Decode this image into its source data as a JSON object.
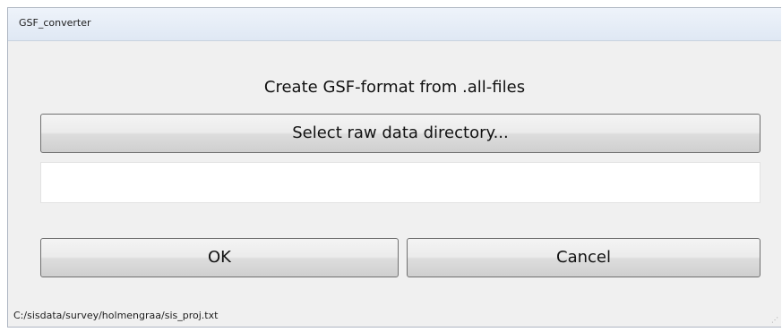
{
  "window": {
    "title": "GSF_converter"
  },
  "header": {
    "text": "Create GSF-format from .all-files"
  },
  "select_button": {
    "label": "Select raw data directory..."
  },
  "path_field": {
    "value": "",
    "placeholder": ""
  },
  "ok_button": {
    "label": "OK"
  },
  "cancel_button": {
    "label": "Cancel"
  },
  "status_bar": {
    "text": "C:/sisdata/survey/holmengraa/sis_proj.txt"
  },
  "icons": {
    "size_grip": "resize-grip-icon"
  }
}
